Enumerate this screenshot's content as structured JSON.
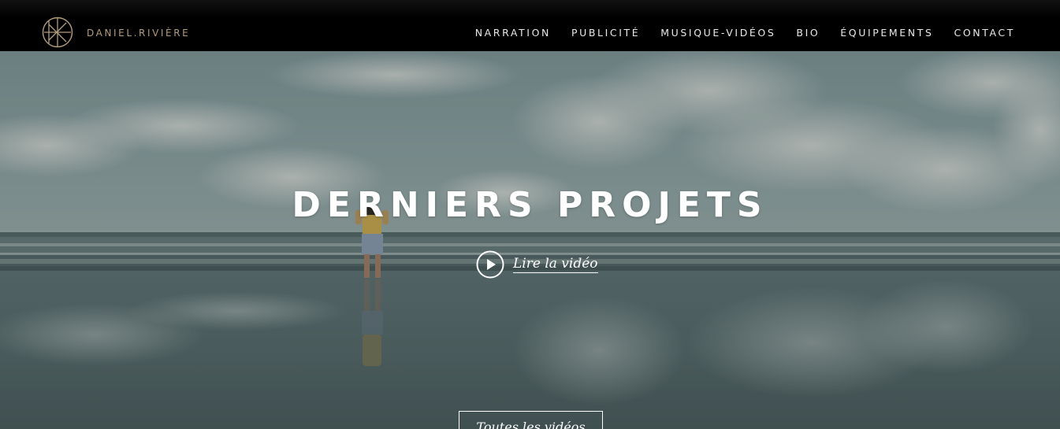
{
  "header": {
    "brand": "DANIEL.RIVIÈRE",
    "logo_icon": "monogram-logo-icon",
    "nav": [
      {
        "label": "NARRATION"
      },
      {
        "label": "PUBLICITÉ"
      },
      {
        "label": "MUSIQUE-VIDÉOS"
      },
      {
        "label": "BIO"
      },
      {
        "label": "ÉQUIPEMENTS"
      },
      {
        "label": "CONTACT"
      }
    ]
  },
  "hero": {
    "title": "DERNIERS PROJETS",
    "play_icon": "play-circle-icon",
    "play_label": "Lire la vidéo",
    "all_videos_label": "Toutes les vidéos"
  },
  "colors": {
    "header_bg": "#000000",
    "brand_gold": "#b29d7c",
    "nav_text": "#e8e8e8",
    "hero_text": "#ffffff"
  }
}
